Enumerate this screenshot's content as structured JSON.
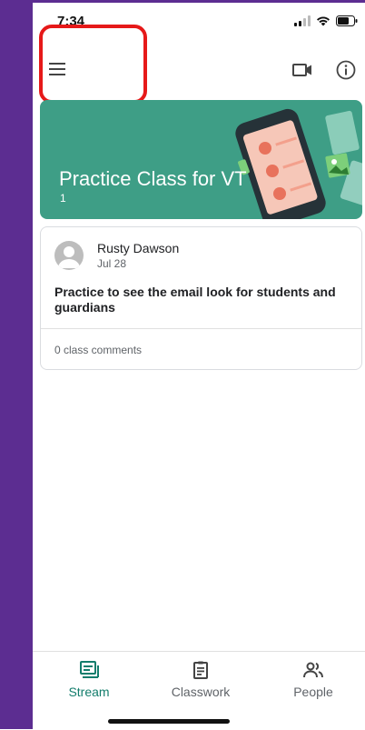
{
  "status_bar": {
    "time": "7:34"
  },
  "header": {
    "menu_icon": "hamburger-menu-icon",
    "video_icon": "video-camera-icon",
    "info_icon": "info-icon"
  },
  "banner": {
    "class_title": "Practice Class for VT",
    "section": "1",
    "color": "#3e9e86"
  },
  "post": {
    "author": "Rusty Dawson",
    "date": "Jul 28",
    "text": "Practice to see the email look for students and guardians",
    "comments": "0 class comments"
  },
  "bottom_nav": {
    "items": [
      {
        "label": "Stream",
        "icon": "stream-icon",
        "active": true
      },
      {
        "label": "Classwork",
        "icon": "classwork-icon",
        "active": false
      },
      {
        "label": "People",
        "icon": "people-icon",
        "active": false
      }
    ]
  },
  "colors": {
    "accent": "#137d6c",
    "sidebar_purple": "#5c2d91",
    "highlight_red": "#e61919"
  }
}
